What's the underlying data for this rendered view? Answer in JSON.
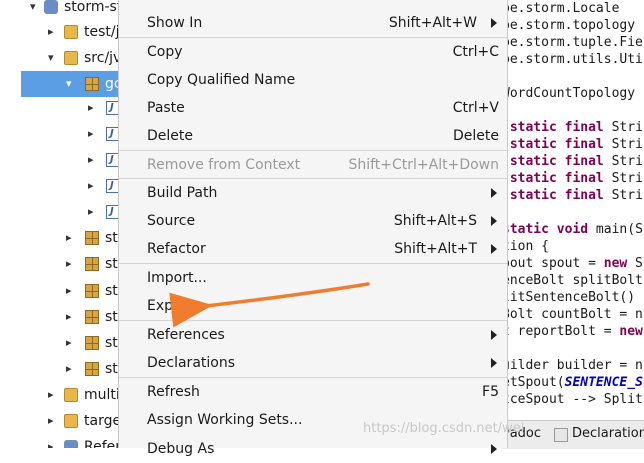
{
  "tree": {
    "rows": [
      {
        "label": "storm-st",
        "twisty": "▾",
        "icon": "project"
      },
      {
        "label": "test/j",
        "twisty": "▸",
        "icon": "source-folder"
      },
      {
        "label": "src/jv",
        "twisty": "▾",
        "icon": "source-folder"
      },
      {
        "label": "gc",
        "twisty": "▾",
        "icon": "package",
        "selected": true
      },
      {
        "label": "",
        "twisty": "▸",
        "icon": "java-file"
      },
      {
        "label": "",
        "twisty": "▸",
        "icon": "java-file"
      },
      {
        "label": "",
        "twisty": "▸",
        "icon": "java-file"
      },
      {
        "label": "",
        "twisty": "▸",
        "icon": "java-file"
      },
      {
        "label": "",
        "twisty": "▸",
        "icon": "java-file"
      },
      {
        "label": "st",
        "twisty": "▸",
        "icon": "package"
      },
      {
        "label": "st",
        "twisty": "▸",
        "icon": "package"
      },
      {
        "label": "st",
        "twisty": "▸",
        "icon": "package"
      },
      {
        "label": "st",
        "twisty": "▸",
        "icon": "package"
      },
      {
        "label": "st",
        "twisty": "▸",
        "icon": "package"
      },
      {
        "label": "st",
        "twisty": "▸",
        "icon": "package"
      },
      {
        "label": "multi",
        "twisty": "▸",
        "icon": "source-folder"
      },
      {
        "label": "targe",
        "twisty": "▸",
        "icon": "folder"
      },
      {
        "label": "Refer",
        "twisty": "▸",
        "icon": "library"
      }
    ]
  },
  "menu": {
    "items": [
      {
        "label": "Show In",
        "accel": "Shift+Alt+W",
        "submenu": true,
        "disabled": false
      },
      {
        "label": "Copy",
        "accel": "Ctrl+C",
        "submenu": false,
        "disabled": false
      },
      {
        "label": "Copy Qualified Name",
        "accel": "",
        "submenu": false,
        "disabled": false
      },
      {
        "label": "Paste",
        "accel": "Ctrl+V",
        "submenu": false,
        "disabled": false
      },
      {
        "label": "Delete",
        "accel": "Delete",
        "submenu": false,
        "disabled": false
      },
      {
        "label": "Remove from Context",
        "accel": "Shift+Ctrl+Alt+Down",
        "submenu": false,
        "disabled": true
      },
      {
        "label": "Build Path",
        "accel": "",
        "submenu": true,
        "disabled": false
      },
      {
        "label": "Source",
        "accel": "Shift+Alt+S",
        "submenu": true,
        "disabled": false
      },
      {
        "label": "Refactor",
        "accel": "Shift+Alt+T",
        "submenu": true,
        "disabled": false
      },
      {
        "label": "Import...",
        "accel": "",
        "submenu": false,
        "disabled": false
      },
      {
        "label": "Export...",
        "accel": "",
        "submenu": false,
        "disabled": false
      },
      {
        "label": "References",
        "accel": "",
        "submenu": true,
        "disabled": false
      },
      {
        "label": "Declarations",
        "accel": "",
        "submenu": true,
        "disabled": false
      },
      {
        "label": "Refresh",
        "accel": "F5",
        "submenu": false,
        "disabled": false
      },
      {
        "label": "Assign Working Sets...",
        "accel": "",
        "submenu": false,
        "disabled": false
      },
      {
        "label": "Debug As",
        "accel": "",
        "submenu": true,
        "disabled": false
      }
    ]
  },
  "editor": {
    "lines": [
      "pe.storm.Locale",
      "pe.storm.topology",
      "pe.storm.tuple.Fie",
      "pe.storm.utils.Uti",
      "",
      "WordCountTopology",
      "",
      " static final Stri",
      " static final Stri",
      " static final Stri",
      " static final Stri",
      " static final Stri",
      "",
      "static void main(S",
      "tion {",
      "pout spout = new S",
      "enceBolt splitBolt",
      "litSentenceBolt()",
      "Bolt countBolt = n",
      "t reportBolt = new",
      "",
      "uilder builder = n",
      "etSpout(SENTENCE_S",
      "tceSpout --> SplitS"
    ]
  },
  "bottombar": {
    "tab1": "vadoc",
    "tab2": "Declaration"
  },
  "watermark": "https://blog.csdn.net/wei..."
}
